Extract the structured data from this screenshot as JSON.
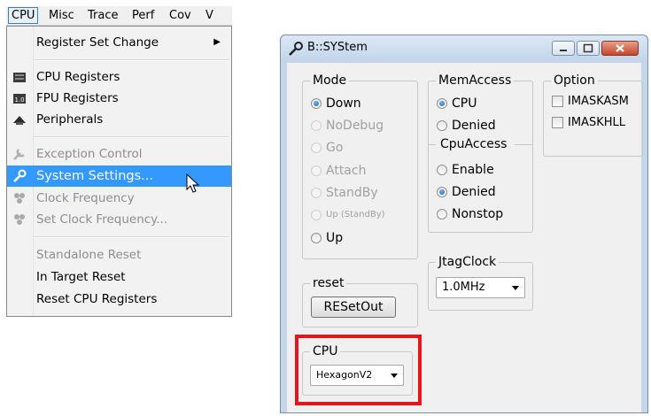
{
  "menubar": {
    "items": [
      "CPU",
      "Misc",
      "Trace",
      "Perf",
      "Cov",
      "V"
    ]
  },
  "dropdown": {
    "items": [
      {
        "label": "Register Set Change",
        "icon": "none",
        "disabled": false,
        "submenu": true
      },
      {
        "label": "CPU Registers",
        "icon": "cpu-registers-icon",
        "disabled": false
      },
      {
        "label": "FPU Registers",
        "icon": "fpu-registers-icon",
        "disabled": false
      },
      {
        "label": "Peripherals",
        "icon": "peripherals-icon",
        "disabled": false
      },
      {
        "label": "Exception Control",
        "icon": "exception-control-icon",
        "disabled": true
      },
      {
        "label": "System Settings...",
        "icon": "wrench-icon",
        "disabled": false,
        "selected": true
      },
      {
        "label": "Clock Frequency",
        "icon": "clock-frequency-icon",
        "disabled": true
      },
      {
        "label": "Set Clock Frequency...",
        "icon": "set-clock-frequency-icon",
        "disabled": true
      },
      {
        "label": "Standalone Reset",
        "icon": "none",
        "disabled": true
      },
      {
        "label": "In Target Reset",
        "icon": "none",
        "disabled": false
      },
      {
        "label": "Reset CPU Registers",
        "icon": "none",
        "disabled": false
      }
    ]
  },
  "window": {
    "title": "B::SYStem",
    "mode": {
      "label": "Mode",
      "options": [
        "Down",
        "NoDebug",
        "Go",
        "Attach",
        "StandBy",
        "Up (StandBy)",
        "Up"
      ],
      "selected": "Down"
    },
    "memaccess": {
      "label": "MemAccess",
      "options": [
        "CPU",
        "Denied"
      ],
      "selected": "CPU"
    },
    "cpuaccess": {
      "label": "CpuAccess",
      "options": [
        "Enable",
        "Denied",
        "Nonstop"
      ],
      "selected": "Denied"
    },
    "option": {
      "label": "Option",
      "checks": [
        "IMASKASM",
        "IMASKHLL"
      ]
    },
    "reset": {
      "label": "reset",
      "button": "RESetOut"
    },
    "jtagclock": {
      "label": "JtagClock",
      "value": "1.0MHz"
    },
    "cpu": {
      "label": "CPU",
      "value": "HexagonV2"
    }
  },
  "colors": {
    "selection": "#3399ff",
    "highlight_box": "#e4161b",
    "window_frame": "#c5d6ea"
  }
}
